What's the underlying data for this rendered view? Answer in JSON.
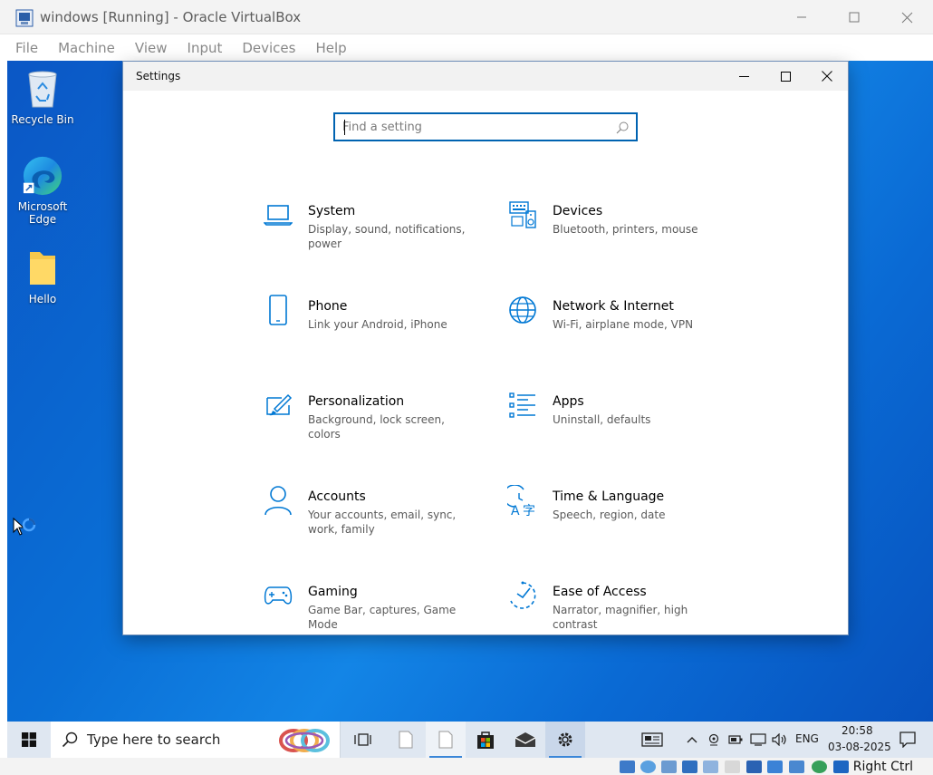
{
  "vbox": {
    "title": "windows [Running] - Oracle VirtualBox",
    "menu": [
      "File",
      "Machine",
      "View",
      "Input",
      "Devices",
      "Help"
    ],
    "host_key": "Right Ctrl"
  },
  "desktop": {
    "icons": [
      {
        "label": "Recycle Bin",
        "icon": "recycle-bin-icon"
      },
      {
        "label": "Microsoft\nEdge",
        "icon": "edge-icon"
      },
      {
        "label": "Hello",
        "icon": "folder-icon"
      }
    ]
  },
  "settings": {
    "title": "Settings",
    "search_placeholder": "Find a setting",
    "categories": [
      {
        "name": "System",
        "desc": "Display, sound, notifications, power",
        "icon": "laptop-icon"
      },
      {
        "name": "Devices",
        "desc": "Bluetooth, printers, mouse",
        "icon": "keyboard-speaker-icon"
      },
      {
        "name": "Phone",
        "desc": "Link your Android, iPhone",
        "icon": "phone-icon"
      },
      {
        "name": "Network & Internet",
        "desc": "Wi-Fi, airplane mode, VPN",
        "icon": "globe-icon"
      },
      {
        "name": "Personalization",
        "desc": "Background, lock screen, colors",
        "icon": "paint-icon"
      },
      {
        "name": "Apps",
        "desc": "Uninstall, defaults",
        "icon": "apps-list-icon"
      },
      {
        "name": "Accounts",
        "desc": "Your accounts, email, sync, work, family",
        "icon": "person-icon"
      },
      {
        "name": "Time & Language",
        "desc": "Speech, region, date",
        "icon": "time-language-icon"
      },
      {
        "name": "Gaming",
        "desc": "Game Bar, captures, Game Mode",
        "icon": "gamepad-icon"
      },
      {
        "name": "Ease of Access",
        "desc": "Narrator, magnifier, high contrast",
        "icon": "ease-of-access-icon"
      }
    ]
  },
  "taskbar": {
    "search_placeholder": "Type here to search",
    "language": "ENG",
    "time": "20:58",
    "date": "03-08-2025"
  },
  "colors": {
    "accent": "#0063b1",
    "icon_blue": "#0078d4"
  }
}
